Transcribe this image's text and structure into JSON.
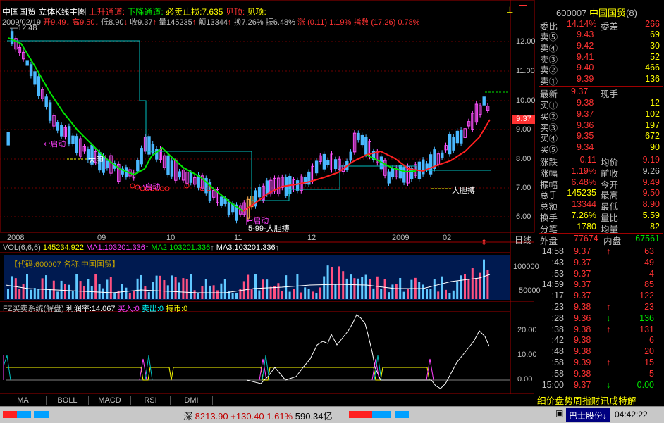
{
  "header": {
    "stock_name": "中国国贸",
    "chart_name": "立体K线主图",
    "up_channel": "上升通道:",
    "down_channel": "下降通道:",
    "stop_loss": "必卖止损:7.635",
    "see_top": "见顶:",
    "see_top2": "见项:",
    "date": "2009/02/19",
    "open": "开9.49",
    "high": "高9.50",
    "low": "低8.90",
    "close": "收9.37",
    "volume": "量145235",
    "amount": "额13344",
    "turnover": "换7.26%",
    "amplitude": "振6.48%",
    "change": "涨 (0.11)",
    "change_pct": "1.19%",
    "index": "指数 (17.26)",
    "index_pct": "0.78%"
  },
  "price_axis": {
    "labels": [
      "12.00",
      "11.00",
      "10.00",
      "9.00",
      "8.00",
      "7.00",
      "6.00"
    ],
    "current": "9.37",
    "max_label": "12.48"
  },
  "time_axis": {
    "labels": [
      "2008",
      "09",
      "10",
      "11",
      "12",
      "2009",
      "02"
    ],
    "period": "日线"
  },
  "annotations": {
    "start1": "启动",
    "start2": "启动",
    "start3": "启动",
    "bold1": "大胆",
    "bold2": "5-99-大胆搏",
    "bold3": "大胆搏",
    "minus_label": "—12.48"
  },
  "volume_panel": {
    "title": "VOL(6,6,6)",
    "vol": "145234.922",
    "ma1": "MA1:103201.336",
    "ma2": "MA2:103201.336",
    "ma3": "MA3:103201.336",
    "code_label": "【代码:600007 名称:中国国贸】",
    "axis": [
      "100000",
      "50000"
    ]
  },
  "fz_panel": {
    "title": "FZ买卖系统(解盘)",
    "profit": "利润率:14.067",
    "buy": "买入:0",
    "sell": "卖出:0",
    "hold": "持币:0",
    "axis": [
      "20.00",
      "10.00",
      "0.00"
    ]
  },
  "tabs": [
    "MA",
    "BOLL",
    "MACD",
    "RSI",
    "DMI"
  ],
  "quote": {
    "code": "600007",
    "name": "中国国贸",
    "suffix": "(8)",
    "weibi_label": "委比",
    "weibi": "14.14%",
    "weicha_label": "委差",
    "weicha": "266",
    "sell": [
      {
        "label": "卖⑤",
        "price": "9.43",
        "vol": "69"
      },
      {
        "label": "卖④",
        "price": "9.42",
        "vol": "30"
      },
      {
        "label": "卖③",
        "price": "9.41",
        "vol": "52"
      },
      {
        "label": "卖②",
        "price": "9.40",
        "vol": "466"
      },
      {
        "label": "卖①",
        "price": "9.39",
        "vol": "136"
      }
    ],
    "latest_label": "最新",
    "latest": "9.37",
    "latest_type": "现手",
    "buy": [
      {
        "label": "买①",
        "price": "9.38",
        "vol": "12"
      },
      {
        "label": "买②",
        "price": "9.37",
        "vol": "102"
      },
      {
        "label": "买③",
        "price": "9.36",
        "vol": "197"
      },
      {
        "label": "买④",
        "price": "9.35",
        "vol": "672"
      },
      {
        "label": "买⑤",
        "price": "9.34",
        "vol": "90"
      }
    ],
    "stats": [
      {
        "l1": "涨跌",
        "v1": "0.11",
        "l2": "均价",
        "v2": "9.19"
      },
      {
        "l1": "涨幅",
        "v1": "1.19%",
        "l2": "前收",
        "v2": "9.26"
      },
      {
        "l1": "振幅",
        "v1": "6.48%",
        "l2": "今开",
        "v2": "9.49"
      },
      {
        "l1": "总手",
        "v1": "145235",
        "l2": "最高",
        "v2": "9.50"
      },
      {
        "l1": "总额",
        "v1": "13344",
        "l2": "最低",
        "v2": "8.90"
      },
      {
        "l1": "换手",
        "v1": "7.26%",
        "l2": "量比",
        "v2": "5.59"
      },
      {
        "l1": "分笔",
        "v1": "1780",
        "l2": "均量",
        "v2": "82"
      }
    ],
    "outer_label": "外盘",
    "outer": "77674",
    "inner_label": "内盘",
    "inner": "67561"
  },
  "ticks": [
    {
      "t": "14:58",
      "p": "9.37",
      "a": "↑",
      "v": "63"
    },
    {
      "t": ":43",
      "p": "9.37",
      "a": "",
      "v": "49"
    },
    {
      "t": ":53",
      "p": "9.37",
      "a": "",
      "v": "4"
    },
    {
      "t": "14:59",
      "p": "9.37",
      "a": "",
      "v": "85"
    },
    {
      "t": ":17",
      "p": "9.37",
      "a": "",
      "v": "122"
    },
    {
      "t": ":23",
      "p": "9.38",
      "a": "↑",
      "v": "23"
    },
    {
      "t": ":28",
      "p": "9.36",
      "a": "↓",
      "v": "136"
    },
    {
      "t": ":38",
      "p": "9.38",
      "a": "↑",
      "v": "131"
    },
    {
      "t": ":42",
      "p": "9.38",
      "a": "",
      "v": "6"
    },
    {
      "t": ":48",
      "p": "9.38",
      "a": "",
      "v": "20"
    },
    {
      "t": ":58",
      "p": "9.39",
      "a": "↑",
      "v": "15"
    },
    {
      "t": ":58",
      "p": "9.38",
      "a": "",
      "v": "5"
    },
    {
      "t": "15:00",
      "p": "9.37",
      "a": "↓",
      "v": "0.00"
    }
  ],
  "right_tabs": "细价盘势周指财讯成特解",
  "statusbar": {
    "market": "深",
    "index": "8213.90",
    "change": "+130.40",
    "pct": "1.61%",
    "amount": "590.34亿",
    "ticker": "巴士股份↓",
    "time": "04:42:22"
  },
  "chart_data": {
    "type": "candlestick",
    "x_labels": [
      "2008",
      "09",
      "10",
      "11",
      "12",
      "2009",
      "02"
    ],
    "ylim": [
      6.0,
      12.48
    ],
    "y_ticks": [
      12.0,
      11.0,
      10.0,
      9.0,
      8.0,
      7.0,
      6.0
    ],
    "last_close": 9.37
  }
}
